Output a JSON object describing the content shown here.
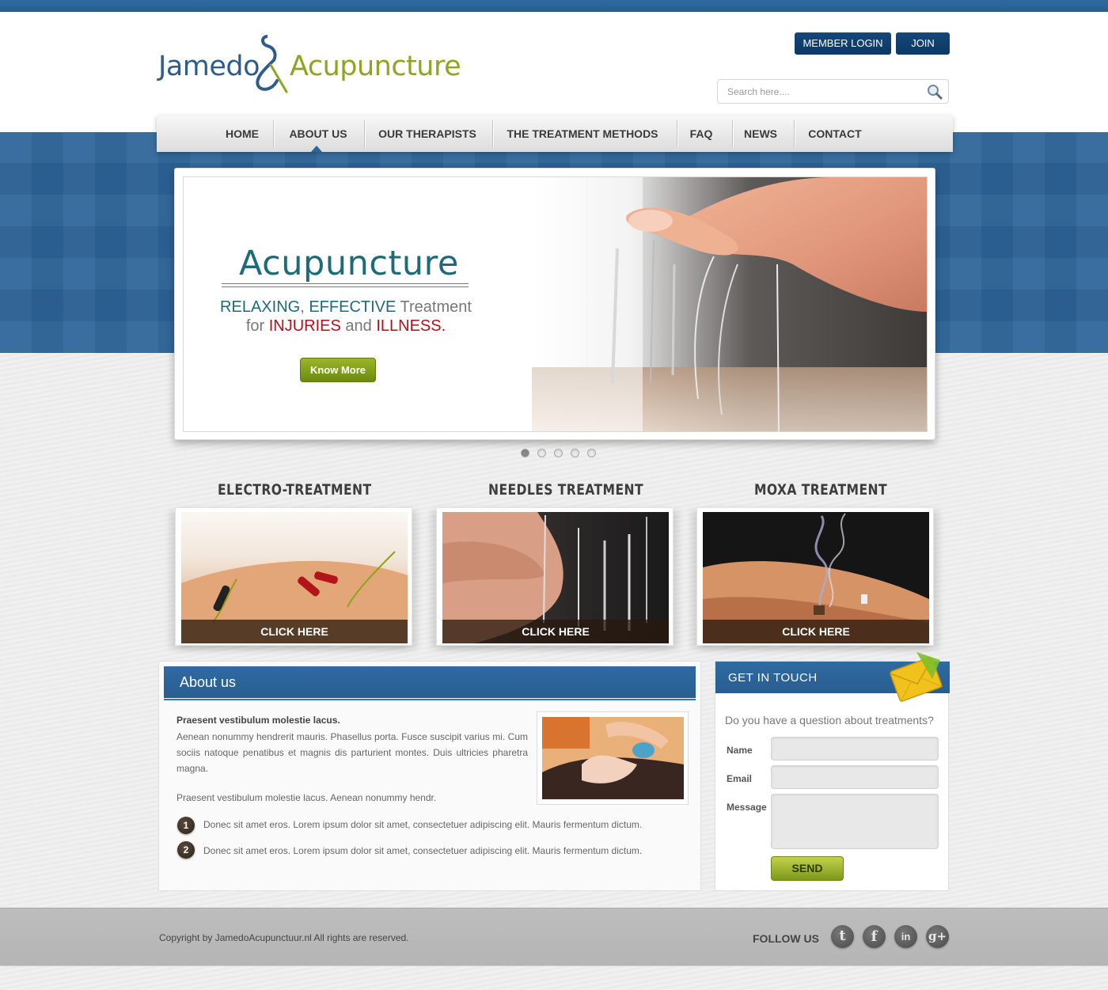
{
  "brand": {
    "name_part1": "Jamedo",
    "name_part2": "Acupuncture"
  },
  "header": {
    "member_login_label": "MEMBER LOGIN",
    "join_label": "JOIN",
    "search_placeholder": "Search here...."
  },
  "nav": {
    "items": [
      {
        "label": "HOME"
      },
      {
        "label": "ABOUT US",
        "active": true
      },
      {
        "label": "OUR THERAPISTS"
      },
      {
        "label": "THE TREATMENT METHODS"
      },
      {
        "label": "FAQ"
      },
      {
        "label": "NEWS"
      },
      {
        "label": "CONTACT"
      }
    ]
  },
  "hero": {
    "title": "Acupuncture",
    "tag_relaxing": "RELAXING",
    "tag_comma": ",",
    "tag_effective": "EFFECTIVE",
    "tag_treatment": "Treatment",
    "tag_for": "for",
    "tag_injuries": "INJURIES",
    "tag_and": "and",
    "tag_illness": "ILLNESS.",
    "button_label": "Know More",
    "slide_count": 5,
    "active_slide": 1
  },
  "treatments": [
    {
      "title": "ELECTRO-TREATMENT",
      "cta": "CLICK HERE"
    },
    {
      "title": "NEEDLES TREATMENT",
      "cta": "CLICK HERE"
    },
    {
      "title": "MOXA TREATMENT",
      "cta": "CLICK HERE"
    }
  ],
  "about": {
    "heading": "About us",
    "lead": "Praesent vestibulum molestie lacus.",
    "paragraph1": "Aenean nonummy hendrerit mauris. Phasellus porta. Fusce suscipit varius mi. Cum sociis natoque penatibus et magnis dis parturient montes. Duis ultricies pharetra magna.",
    "paragraph2": "Praesent vestibulum molestie lacus. Aenean nonummy hendr.",
    "list": [
      {
        "number": "1",
        "text": "Donec sit amet eros. Lorem ipsum dolor sit amet, consectetuer adipiscing elit. Mauris fermentum dictum."
      },
      {
        "number": "2",
        "text": "Donec sit amet eros. Lorem ipsum dolor sit amet, consectetuer adipiscing elit. Mauris fermentum dictum."
      }
    ]
  },
  "contact": {
    "heading": "GET IN TOUCH",
    "question": "Do you have a question about treatments?",
    "name_label": "Name",
    "email_label": "Email",
    "message_label": "Message",
    "send_label": "SEND"
  },
  "footer": {
    "copyright": "Copyright by JamedoAcupunctuur.nl  All rights are reserved.",
    "follow_label": "FOLLOW US",
    "social_icons": [
      "twitter-icon",
      "facebook-icon",
      "linkedin-icon",
      "google-plus-icon"
    ],
    "social_glyphs": [
      "t",
      "f",
      "in",
      "g+"
    ]
  },
  "colors": {
    "brand_blue": "#2d6499",
    "brand_green": "#8fa51f",
    "accent_red": "#b0121b",
    "teal": "#1d6a78"
  }
}
